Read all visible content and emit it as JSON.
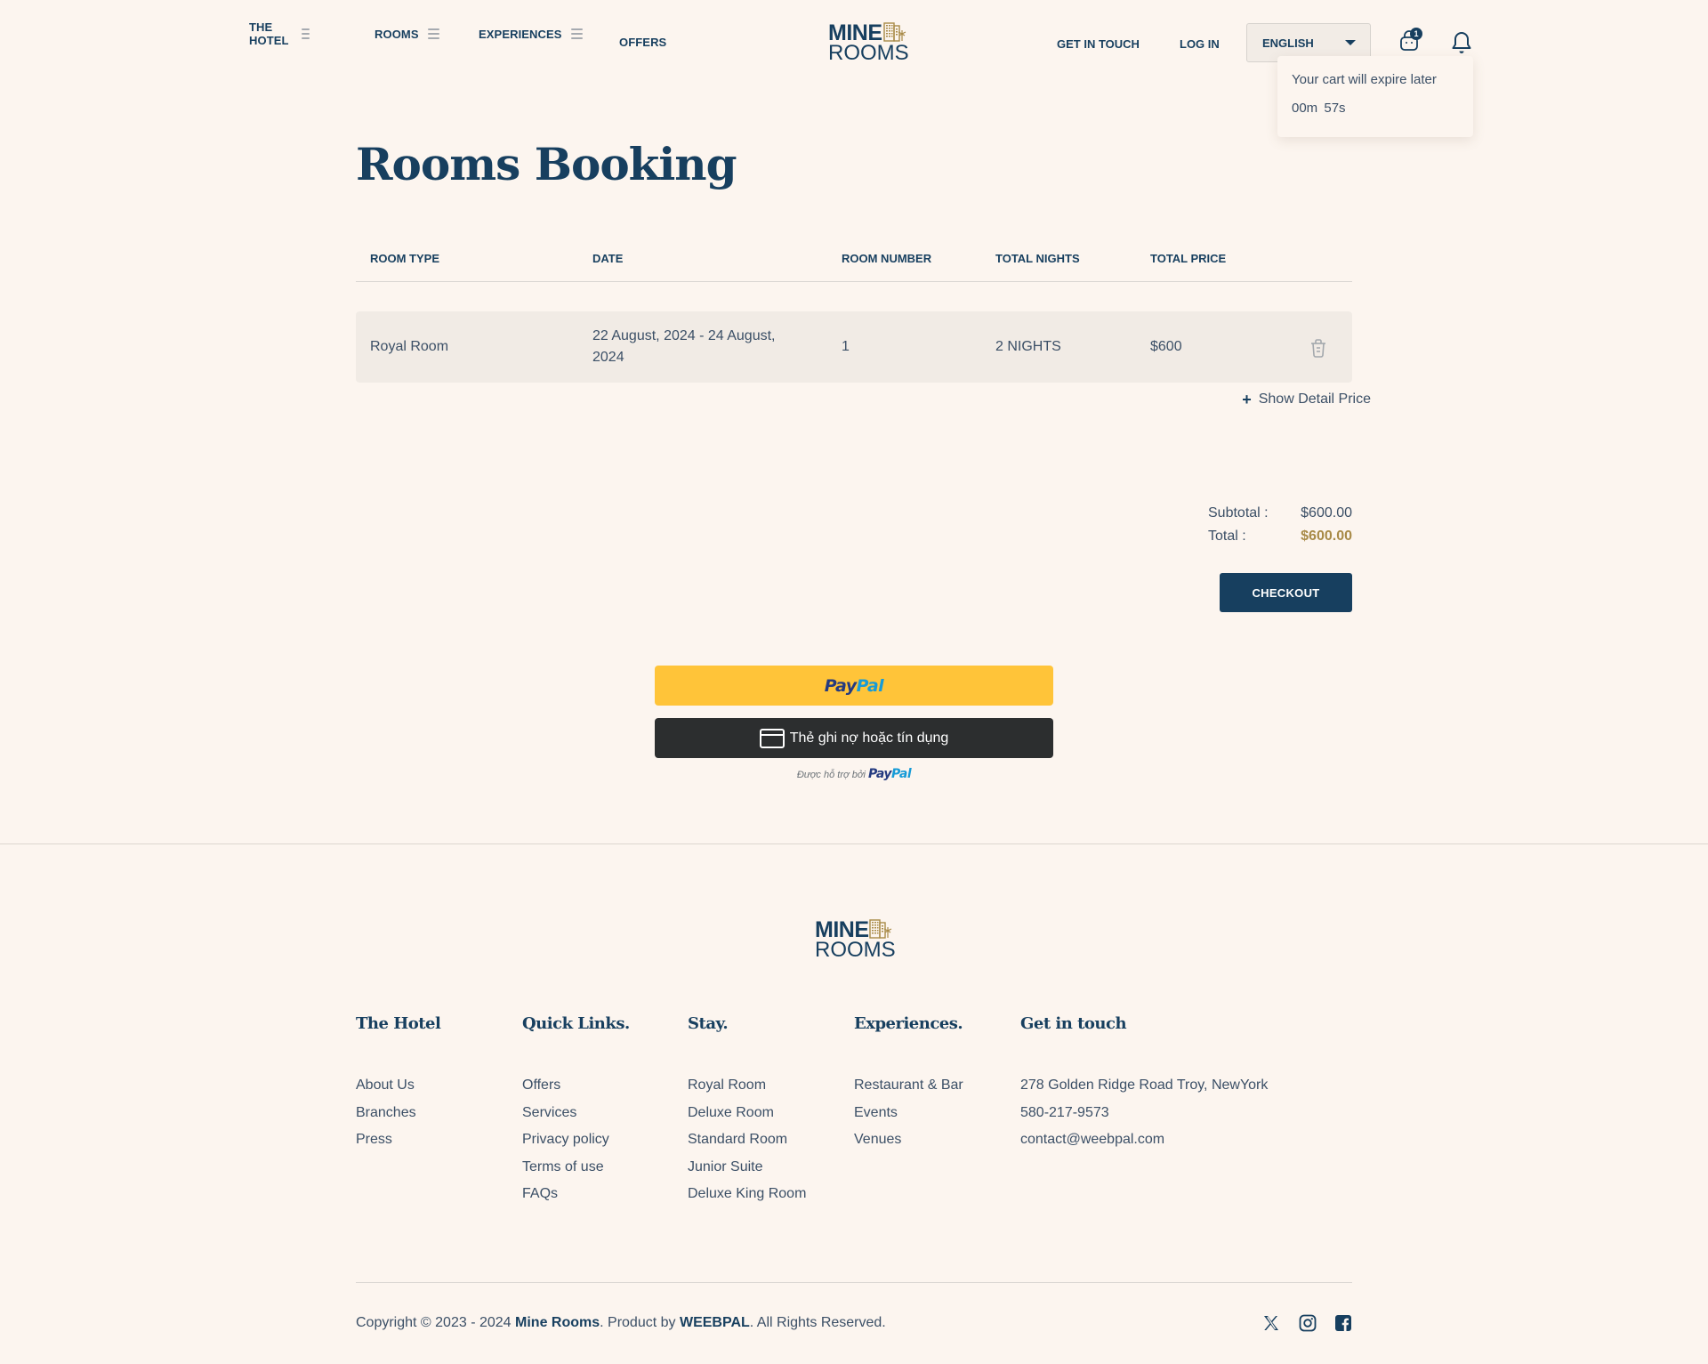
{
  "header": {
    "nav_left": [
      {
        "label": "THE HOTEL",
        "has_menu": true
      },
      {
        "label": "ROOMS",
        "has_menu": true
      },
      {
        "label": "EXPERIENCES",
        "has_menu": true
      },
      {
        "label": "OFFERS",
        "has_menu": false
      }
    ],
    "logo": {
      "line1": "MINE",
      "line2": "ROOMS"
    },
    "get_in_touch": "GET IN TOUCH",
    "log_in": "LOG IN",
    "language": "ENGLISH",
    "cart_count": "1",
    "cart_popup": {
      "message": "Your cart will expire later",
      "timer": "00m 57s"
    }
  },
  "main": {
    "title": "Rooms Booking",
    "table": {
      "headers": [
        "ROOM TYPE",
        "DATE",
        "ROOM NUMBER",
        "TOTAL NIGHTS",
        "TOTAL PRICE"
      ],
      "rows": [
        {
          "room_type": "Royal Room",
          "date": "22 August, 2024 - 24 August, 2024",
          "room_number": "1",
          "total_nights": "2 NIGHTS",
          "total_price": "$600"
        }
      ]
    },
    "show_detail": "Show Detail Price",
    "subtotal_label": "Subtotal :",
    "subtotal_value": "$600.00",
    "total_label": "Total :",
    "total_value": "$600.00",
    "checkout": "CHECKOUT",
    "paypal": {
      "pay": "Pay",
      "pal": "Pal",
      "card_label": "Thẻ ghi nợ hoặc tín dụng",
      "powered_by": "Được hỗ trợ bởi"
    }
  },
  "footer": {
    "logo": {
      "line1": "MINE",
      "line2": "ROOMS"
    },
    "columns": [
      {
        "title": "The Hotel",
        "links": [
          "About Us",
          "Branches",
          "Press"
        ]
      },
      {
        "title": "Quick Links.",
        "links": [
          "Offers",
          "Services",
          "Privacy policy",
          "Terms of use",
          "FAQs"
        ]
      },
      {
        "title": "Stay.",
        "links": [
          "Royal Room",
          "Deluxe Room",
          "Standard Room",
          "Junior Suite",
          "Deluxe King Room"
        ]
      },
      {
        "title": "Experiences.",
        "links": [
          "Restaurant & Bar",
          "Events",
          "Venues"
        ]
      },
      {
        "title": "Get in touch",
        "links": [
          "278 Golden Ridge Road Troy, NewYork",
          "580-217-9573",
          "contact@weebpal.com"
        ]
      }
    ],
    "copyright": {
      "prefix": "Copyright © 2023 - 2024 ",
      "brand": "Mine Rooms",
      "middle": ". Product by ",
      "company": "WEEBPAL",
      "suffix": ". All Rights Reserved."
    },
    "social": [
      "x-icon",
      "instagram-icon",
      "facebook-icon"
    ]
  },
  "colors": {
    "background": "#fcf5ef",
    "navy": "#173f5f",
    "gold": "#a88a47",
    "paypal_yellow": "#ffc439",
    "card_dark": "#2c2e2f"
  }
}
